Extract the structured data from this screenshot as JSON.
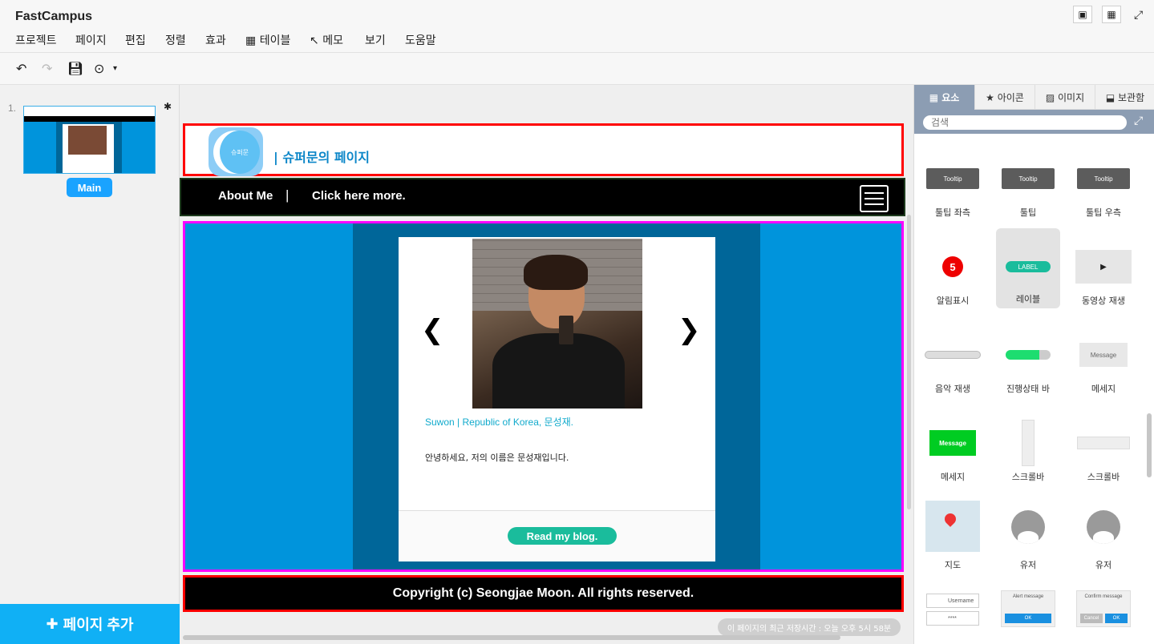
{
  "app": {
    "title": "FastCampus"
  },
  "menu": [
    {
      "label": "프로젝트"
    },
    {
      "label": "페이지"
    },
    {
      "label": "편집"
    },
    {
      "label": "정렬"
    },
    {
      "label": "효과"
    },
    {
      "label": "테이블",
      "icon": "table-icon"
    },
    {
      "label": "메모",
      "icon": "memo-icon"
    },
    {
      "label": "보기"
    },
    {
      "label": "도움말"
    }
  ],
  "topright": {
    "icons": [
      "film-icon",
      "grid-icon",
      "fullscreen-icon"
    ]
  },
  "toolbar": {
    "icons": [
      "undo-icon",
      "redo-icon",
      "save-icon",
      "play-icon",
      "dropdown-icon"
    ]
  },
  "pages": {
    "number": "1.",
    "items": [
      {
        "name": "Main"
      }
    ],
    "add_label": "페이지 추가"
  },
  "canvas": {
    "header_title": "| 슈퍼문의 페이지",
    "logo_text": "슈퍼문",
    "nav": {
      "about": "About Me",
      "separator": "|",
      "more": "Click here more."
    },
    "caption": "Suwon | Republic of Korea, 문성재.",
    "intro": "안녕하세요, 저의 이름은 문성재입니다.",
    "blog_button": "Read my blog.",
    "footer": "Copyright (c) Seongjae Moon. All rights reserved.",
    "save_status": "이 페이지의 최근 저장시간 : 오늘 오후 5시 58분"
  },
  "panel": {
    "tabs": [
      {
        "label": "요소",
        "icon": "grid-icon",
        "active": true
      },
      {
        "label": "아이콘",
        "icon": "star-icon",
        "active": false
      },
      {
        "label": "이미지",
        "icon": "image-icon",
        "active": false
      },
      {
        "label": "보관함",
        "icon": "inbox-icon",
        "active": false
      }
    ],
    "search_placeholder": "검색",
    "elements": [
      {
        "label": "툴팁 좌측",
        "preview": "Tooltip"
      },
      {
        "label": "툴팁",
        "preview": "Tooltip"
      },
      {
        "label": "툴팁 우측",
        "preview": "Tooltip"
      },
      {
        "label": "알림표시",
        "preview": "5"
      },
      {
        "label": "레이블",
        "preview": "LABEL"
      },
      {
        "label": "동영상 재생",
        "preview": ""
      },
      {
        "label": "음악 재생",
        "preview": ""
      },
      {
        "label": "진행상태 바",
        "preview": ""
      },
      {
        "label": "메세지",
        "preview": "Message"
      },
      {
        "label": "메세지",
        "preview": "Message"
      },
      {
        "label": "스크롤바",
        "preview": ""
      },
      {
        "label": "스크롤바",
        "preview": ""
      },
      {
        "label": "지도",
        "preview": ""
      },
      {
        "label": "유저",
        "preview": ""
      },
      {
        "label": "유저",
        "preview": ""
      },
      {
        "label": "",
        "preview": "Username"
      },
      {
        "label": "",
        "preview": "Alert message"
      },
      {
        "label": "",
        "preview": "Confirm message"
      }
    ],
    "login_password_mask": "****",
    "ok_label": "OK",
    "cancel_label": "Cancel"
  },
  "colors": {
    "accent": "#10b0f5",
    "panel_tab": "#8c9db3",
    "canvas_blue": "#0094dc",
    "canvas_dark": "#006699",
    "teal": "#1abc9c"
  }
}
